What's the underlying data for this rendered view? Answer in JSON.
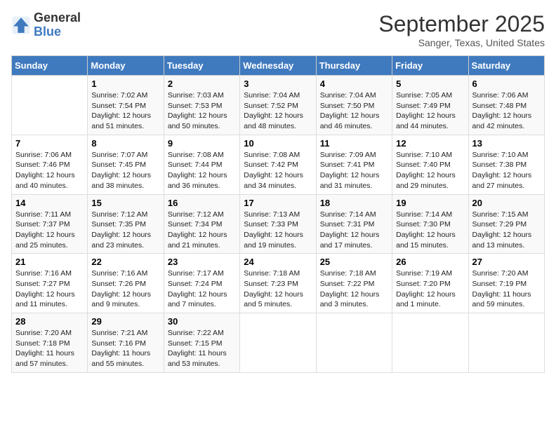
{
  "header": {
    "logo_line1": "General",
    "logo_line2": "Blue",
    "month": "September 2025",
    "location": "Sanger, Texas, United States"
  },
  "weekdays": [
    "Sunday",
    "Monday",
    "Tuesday",
    "Wednesday",
    "Thursday",
    "Friday",
    "Saturday"
  ],
  "weeks": [
    [
      {
        "day": "",
        "info": ""
      },
      {
        "day": "1",
        "info": "Sunrise: 7:02 AM\nSunset: 7:54 PM\nDaylight: 12 hours\nand 51 minutes."
      },
      {
        "day": "2",
        "info": "Sunrise: 7:03 AM\nSunset: 7:53 PM\nDaylight: 12 hours\nand 50 minutes."
      },
      {
        "day": "3",
        "info": "Sunrise: 7:04 AM\nSunset: 7:52 PM\nDaylight: 12 hours\nand 48 minutes."
      },
      {
        "day": "4",
        "info": "Sunrise: 7:04 AM\nSunset: 7:50 PM\nDaylight: 12 hours\nand 46 minutes."
      },
      {
        "day": "5",
        "info": "Sunrise: 7:05 AM\nSunset: 7:49 PM\nDaylight: 12 hours\nand 44 minutes."
      },
      {
        "day": "6",
        "info": "Sunrise: 7:06 AM\nSunset: 7:48 PM\nDaylight: 12 hours\nand 42 minutes."
      }
    ],
    [
      {
        "day": "7",
        "info": "Sunrise: 7:06 AM\nSunset: 7:46 PM\nDaylight: 12 hours\nand 40 minutes."
      },
      {
        "day": "8",
        "info": "Sunrise: 7:07 AM\nSunset: 7:45 PM\nDaylight: 12 hours\nand 38 minutes."
      },
      {
        "day": "9",
        "info": "Sunrise: 7:08 AM\nSunset: 7:44 PM\nDaylight: 12 hours\nand 36 minutes."
      },
      {
        "day": "10",
        "info": "Sunrise: 7:08 AM\nSunset: 7:42 PM\nDaylight: 12 hours\nand 34 minutes."
      },
      {
        "day": "11",
        "info": "Sunrise: 7:09 AM\nSunset: 7:41 PM\nDaylight: 12 hours\nand 31 minutes."
      },
      {
        "day": "12",
        "info": "Sunrise: 7:10 AM\nSunset: 7:40 PM\nDaylight: 12 hours\nand 29 minutes."
      },
      {
        "day": "13",
        "info": "Sunrise: 7:10 AM\nSunset: 7:38 PM\nDaylight: 12 hours\nand 27 minutes."
      }
    ],
    [
      {
        "day": "14",
        "info": "Sunrise: 7:11 AM\nSunset: 7:37 PM\nDaylight: 12 hours\nand 25 minutes."
      },
      {
        "day": "15",
        "info": "Sunrise: 7:12 AM\nSunset: 7:35 PM\nDaylight: 12 hours\nand 23 minutes."
      },
      {
        "day": "16",
        "info": "Sunrise: 7:12 AM\nSunset: 7:34 PM\nDaylight: 12 hours\nand 21 minutes."
      },
      {
        "day": "17",
        "info": "Sunrise: 7:13 AM\nSunset: 7:33 PM\nDaylight: 12 hours\nand 19 minutes."
      },
      {
        "day": "18",
        "info": "Sunrise: 7:14 AM\nSunset: 7:31 PM\nDaylight: 12 hours\nand 17 minutes."
      },
      {
        "day": "19",
        "info": "Sunrise: 7:14 AM\nSunset: 7:30 PM\nDaylight: 12 hours\nand 15 minutes."
      },
      {
        "day": "20",
        "info": "Sunrise: 7:15 AM\nSunset: 7:29 PM\nDaylight: 12 hours\nand 13 minutes."
      }
    ],
    [
      {
        "day": "21",
        "info": "Sunrise: 7:16 AM\nSunset: 7:27 PM\nDaylight: 12 hours\nand 11 minutes."
      },
      {
        "day": "22",
        "info": "Sunrise: 7:16 AM\nSunset: 7:26 PM\nDaylight: 12 hours\nand 9 minutes."
      },
      {
        "day": "23",
        "info": "Sunrise: 7:17 AM\nSunset: 7:24 PM\nDaylight: 12 hours\nand 7 minutes."
      },
      {
        "day": "24",
        "info": "Sunrise: 7:18 AM\nSunset: 7:23 PM\nDaylight: 12 hours\nand 5 minutes."
      },
      {
        "day": "25",
        "info": "Sunrise: 7:18 AM\nSunset: 7:22 PM\nDaylight: 12 hours\nand 3 minutes."
      },
      {
        "day": "26",
        "info": "Sunrise: 7:19 AM\nSunset: 7:20 PM\nDaylight: 12 hours\nand 1 minute."
      },
      {
        "day": "27",
        "info": "Sunrise: 7:20 AM\nSunset: 7:19 PM\nDaylight: 11 hours\nand 59 minutes."
      }
    ],
    [
      {
        "day": "28",
        "info": "Sunrise: 7:20 AM\nSunset: 7:18 PM\nDaylight: 11 hours\nand 57 minutes."
      },
      {
        "day": "29",
        "info": "Sunrise: 7:21 AM\nSunset: 7:16 PM\nDaylight: 11 hours\nand 55 minutes."
      },
      {
        "day": "30",
        "info": "Sunrise: 7:22 AM\nSunset: 7:15 PM\nDaylight: 11 hours\nand 53 minutes."
      },
      {
        "day": "",
        "info": ""
      },
      {
        "day": "",
        "info": ""
      },
      {
        "day": "",
        "info": ""
      },
      {
        "day": "",
        "info": ""
      }
    ]
  ]
}
